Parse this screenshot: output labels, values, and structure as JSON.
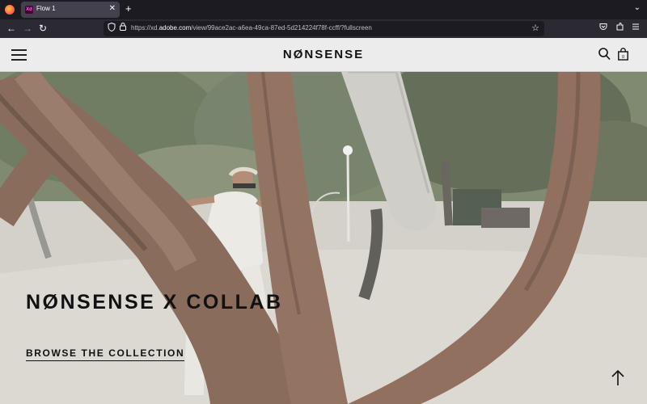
{
  "browser": {
    "tab_title": "Flow 1",
    "tab_favicon_text": "Xd",
    "url_prefix": "https://xd.",
    "url_domain": "adobe.com",
    "url_path": "/view/99ace2ac-a6ea-49ca-87ed-5d214224f78f-ccff/?fullscreen",
    "icons": [
      "firefox-logo",
      "close-icon",
      "plus-icon",
      "chevron-down-icon",
      "back-arrow-icon",
      "forward-arrow-icon",
      "reload-icon",
      "shield-icon",
      "lock-icon",
      "star-icon",
      "pocket-icon",
      "extensions-icon",
      "menu-icon"
    ]
  },
  "site": {
    "logo": "NØNSENSE",
    "header_icons": [
      "hamburger-menu-icon",
      "search-icon",
      "shopping-bag-icon"
    ]
  },
  "hero": {
    "title": "NØNSENSE X COLLAB",
    "cta_label": "BROWSE THE COLLECTION",
    "scroll_icon": "arrow-up-icon",
    "image_description_icon": "hero-photo"
  },
  "colors": {
    "browser_dark": "#1c1b22",
    "browser_nav": "#2b2a33",
    "header_bg": "#ececec",
    "text_dark": "#111111"
  }
}
